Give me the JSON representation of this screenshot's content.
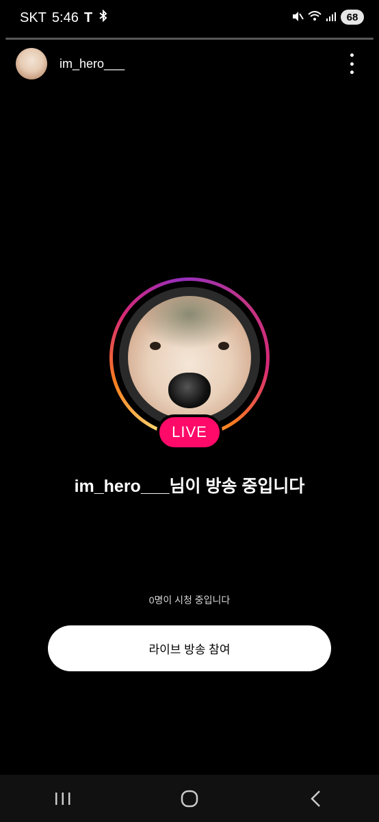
{
  "status_bar": {
    "carrier": "SKT",
    "time": "5:46",
    "battery": "68"
  },
  "story": {
    "progress": 0.0
  },
  "header": {
    "username": "im_hero___"
  },
  "live": {
    "badge": "LIVE",
    "title": "im_hero___님이 방송 중입니다",
    "viewers": "0명이 시청 중입니다",
    "join_label": "라이브 방송 참여"
  },
  "icons": {
    "more": "more-vert-icon",
    "recent": "recent-apps-icon",
    "home": "home-icon",
    "back": "back-icon"
  }
}
